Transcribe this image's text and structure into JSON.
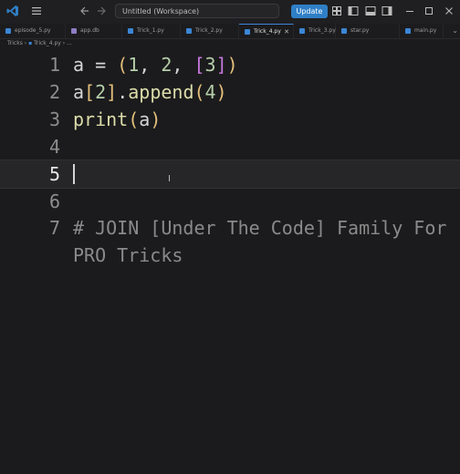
{
  "titlebar": {
    "search_text": "Untitled (Workspace)",
    "update_label": "Update"
  },
  "tabs": [
    {
      "label": "episode_5.py",
      "color": "#3b86d6"
    },
    {
      "label": "app.db",
      "color": "#8e7cc3"
    },
    {
      "label": "Trick_1.py",
      "color": "#3b86d6"
    },
    {
      "label": "Trick_2.py",
      "color": "#3b86d6"
    },
    {
      "label": "Trick_4.py",
      "color": "#3b86d6",
      "active": true
    },
    {
      "label": "Trick_3.py",
      "color": "#3b86d6"
    },
    {
      "label": "star.py",
      "color": "#3b86d6"
    },
    {
      "label": "main.py",
      "color": "#3b86d6"
    }
  ],
  "breadcrumb": {
    "folder": "Tricks",
    "file": "Trick_4.py",
    "more": "..."
  },
  "editor": {
    "line_numbers": [
      "1",
      "2",
      "3",
      "4",
      "5",
      "6",
      "7"
    ],
    "line1": {
      "a": "a",
      "eq": " = ",
      "open": "(",
      "one": "1",
      "c1": ", ",
      "two": "2",
      "c2": ", ",
      "lb": "[",
      "three": "3",
      "rb": "]",
      "close": ")"
    },
    "line2": {
      "a": "a",
      "lb": "[",
      "two": "2",
      "rb": "]",
      "dot": ".",
      "fn": "append",
      "open": "(",
      "four": "4",
      "close": ")"
    },
    "line3": {
      "fn": "print",
      "open": "(",
      "a": "a",
      "close": ")"
    },
    "line7a": "# JOIN [Under The Code] Family For",
    "line7b": "PRO Tricks",
    "ibeam": "I"
  },
  "colors": {
    "keyword_yellow": "#e5c07b",
    "bracket_purple": "#c678dd",
    "function": "#dcdcaa",
    "number": "#b5cea8",
    "accent": "#2f7fc7"
  }
}
